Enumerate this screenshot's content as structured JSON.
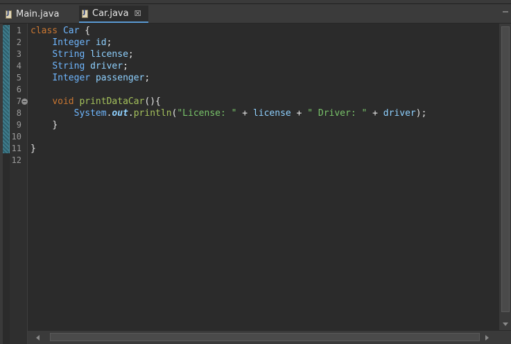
{
  "tabs": [
    {
      "label": "Main.java",
      "icon": "java-file-icon",
      "active": false
    },
    {
      "label": "Car.java",
      "icon": "java-file-icon",
      "active": true,
      "close_glyph": "☒"
    }
  ],
  "line_numbers": [
    "1",
    "2",
    "3",
    "4",
    "5",
    "6",
    "7",
    "8",
    "9",
    "10",
    "11",
    "12"
  ],
  "code": {
    "l1": {
      "kw": "class",
      "name": "Car",
      "rest": " {"
    },
    "l2": {
      "type": "Integer",
      "name": "id",
      "end": ";"
    },
    "l3": {
      "type": "String",
      "name": "license",
      "end": ";"
    },
    "l4": {
      "type": "String",
      "name": "driver",
      "end": ";"
    },
    "l5": {
      "type": "Integer",
      "name": "passenger",
      "end": ";"
    },
    "l7": {
      "kw": "void",
      "fn": "printDataCar",
      "rest": "(){"
    },
    "l8": {
      "cls": "System",
      "dot1": ".",
      "fld": "out",
      "dot2": ".",
      "fn": "println",
      "open": "(",
      "s1": "\"License: \"",
      "plus1": " + ",
      "v1": "license",
      "plus2": " + ",
      "s2": "\" Driver: \"",
      "plus3": " + ",
      "v2": "driver",
      "close": ");"
    },
    "l9": {
      "text": "}"
    },
    "l11": {
      "text": "}"
    }
  },
  "colors": {
    "keyword": "#cc7832",
    "type": "#6fb7ff",
    "identifier": "#8fd1ff",
    "method": "#a5c25c",
    "string": "#79c46a",
    "background": "#2b2b2b",
    "tab_underline": "#5b9bd5"
  }
}
